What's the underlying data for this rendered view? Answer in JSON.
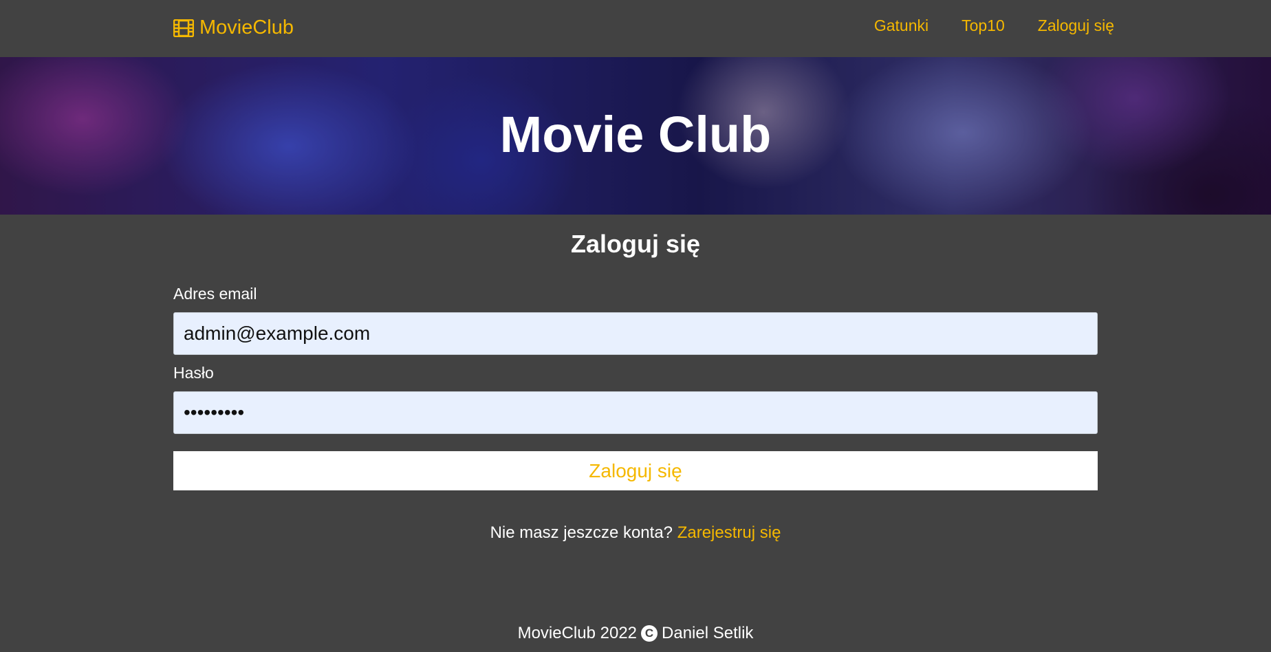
{
  "colors": {
    "background": "#424242",
    "accent": "#f5b800",
    "input_bg": "#e8f0fe"
  },
  "navbar": {
    "brand_icon": "film-icon",
    "brand_label": "MovieClub",
    "links": [
      {
        "label": "Gatunki"
      },
      {
        "label": "Top10"
      },
      {
        "label": "Zaloguj się"
      }
    ]
  },
  "hero": {
    "title": "Movie Club"
  },
  "login": {
    "title": "Zaloguj się",
    "email_label": "Adres email",
    "email_value": "admin@example.com",
    "password_label": "Hasło",
    "password_value": "•••••••••",
    "submit_label": "Zaloguj się"
  },
  "register": {
    "prompt": "Nie masz jeszcze konta?",
    "link_label": "Zarejestruj się"
  },
  "footer": {
    "prefix": "MovieClub 2022",
    "copyright_icon": "copyright-icon",
    "copyright_symbol": "C",
    "author": "Daniel Setlik"
  }
}
